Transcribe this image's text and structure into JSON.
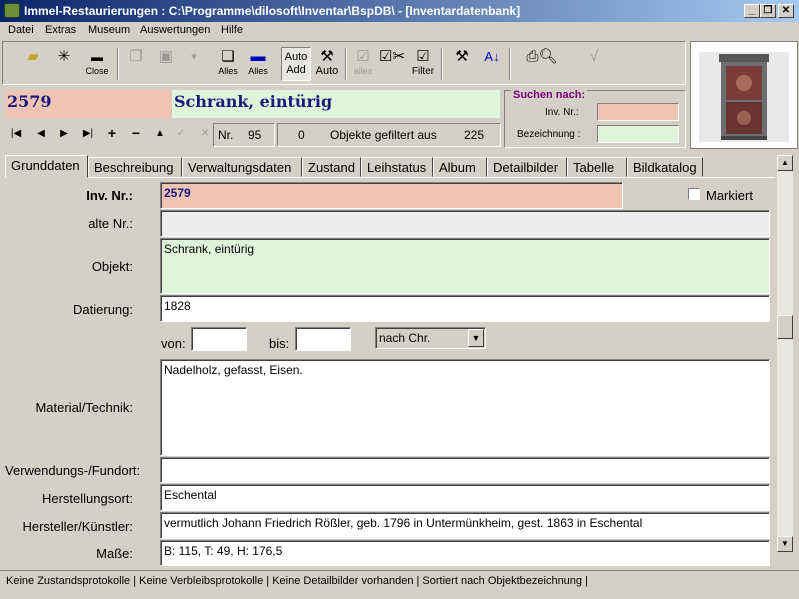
{
  "window": {
    "title": "Immel-Restaurierungen : C:\\Programme\\dilosoft\\Inventar\\BspDB\\ - [Inventardatenbank]",
    "minimize": "_",
    "restore": "❐",
    "close": "✕"
  },
  "menu": [
    "Datei",
    "Extras",
    "Museum",
    "Auswertungen",
    "Hilfe"
  ],
  "toolbar": {
    "close_label": "Close",
    "alles_label_1": "Alles",
    "alles_label_2": "Alles",
    "auto_add_label_1": "Auto",
    "auto_add_label_2": "Add",
    "auto_label": "Auto",
    "alles_disabled_label": "alles",
    "filter_label": "Filter"
  },
  "record": {
    "inv_nr": "2579",
    "objekt": "Schrank, eintürig"
  },
  "navigation": {
    "nr_label": "Nr.",
    "nr_value": "95",
    "filtered_count": "0",
    "filtered_text": "Objekte gefiltert aus",
    "total": "225"
  },
  "search": {
    "title": "Suchen nach:",
    "inv_label": "Inv. Nr.:",
    "bez_label": "Bezeichnung :",
    "inv_value": "",
    "bez_value": ""
  },
  "tabs": [
    "Grunddaten",
    "Beschreibung",
    "Verwaltungsdaten",
    "Zustand",
    "Leihstatus",
    "Album",
    "Detailbilder",
    "Tabelle",
    "Bildkatalog"
  ],
  "form": {
    "inv_label": "Inv. Nr.:",
    "inv_value": "2579",
    "markiert_label": "Markiert",
    "alte_label": "alte Nr.:",
    "alte_value": "",
    "objekt_label": "Objekt:",
    "objekt_value": "Schrank, eintürig",
    "datierung_label": "Datierung:",
    "datierung_value": "1828",
    "von_label": "von:",
    "von_value": "",
    "bis_label": "bis:",
    "bis_value": "",
    "era_value": "nach Chr.",
    "material_label": "Material/Technik:",
    "material_value": "Nadelholz, gefasst, Eisen.",
    "fundort_label": "Verwendungs-/Fundort:",
    "fundort_value": "",
    "herstellungsort_label": "Herstellungsort:",
    "herstellungsort_value": "Eschental",
    "hersteller_label": "Hersteller/Künstler:",
    "hersteller_value": "vermutlich Johann Friedrich Rößler, geb. 1796 in Untermünkheim, gest. 1863 in Eschental",
    "masse_label": "Maße:",
    "masse_value": "B: 115, T: 49, H: 176,5"
  },
  "status": "Keine  Zustandsprotokolle |  Keine  Verbleibsprotokolle |  Keine  Detailbilder vorhanden |    Sortiert nach Objektbezeichnung |",
  "colors": {
    "inv_bg": "#f0c4b4",
    "objekt_bg": "#dff5d9",
    "record_text": "#1a1a7e",
    "search_title": "#800080"
  }
}
